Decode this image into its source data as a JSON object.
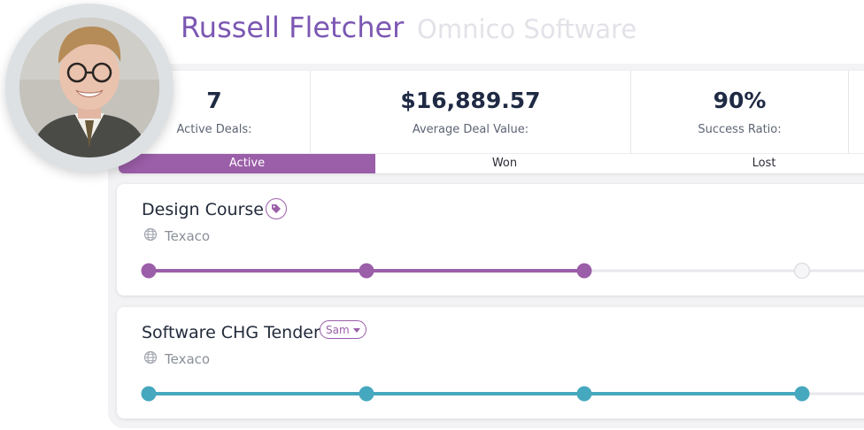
{
  "profile": {
    "name": "Russell Fletcher",
    "company": "Omnico Software",
    "avatar_icon": "person-photo"
  },
  "stats": [
    {
      "value": "7",
      "label": "Active Deals:"
    },
    {
      "value": "$16,889.57",
      "label": "Average Deal Value:"
    },
    {
      "value": "90%",
      "label": "Success Ratio:"
    }
  ],
  "tabs": [
    {
      "label": "Active",
      "active": true
    },
    {
      "label": "Won",
      "active": false
    },
    {
      "label": "Lost",
      "active": false
    }
  ],
  "deals": [
    {
      "title": "Design Course",
      "badge": "tag-icon",
      "company": "Texaco",
      "stages_total": 5,
      "stages_completed": 3,
      "color": "#9b5ea8"
    },
    {
      "title": "Software CHG Tender",
      "owner": "Sam",
      "company": "Texaco",
      "stages_total": 5,
      "stages_completed": 4,
      "color": "#46a8be"
    }
  ],
  "colors": {
    "accent": "#9b5ea8",
    "teal": "#46a8be",
    "name": "#7c58b3"
  }
}
